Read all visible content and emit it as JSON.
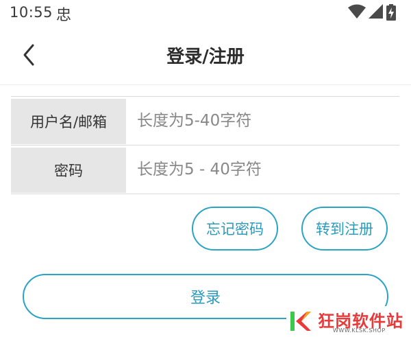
{
  "status_bar": {
    "time": "10:55",
    "notification_glyph": "忠",
    "icons": [
      "wifi-icon",
      "cellular-signal-icon",
      "battery-charging-icon"
    ]
  },
  "header": {
    "back_icon": "chevron-left-icon",
    "title": "登录/注册"
  },
  "form": {
    "username": {
      "label": "用户名/邮箱",
      "value": "",
      "placeholder": "长度为5-40字符"
    },
    "password": {
      "label": "密码",
      "value": "",
      "placeholder": "长度为5 - 40字符"
    }
  },
  "actions": {
    "forgot_password": "忘记密码",
    "go_register": "转到注册",
    "login": "登录"
  },
  "watermark": {
    "logo_text": "K",
    "name": "狂岗软件站",
    "url": "WWW.KLSK.SHOP"
  },
  "colors": {
    "accent": "#2aa3c4",
    "label_bg": "#e6e6e6",
    "watermark_red": "#e83a3a"
  }
}
